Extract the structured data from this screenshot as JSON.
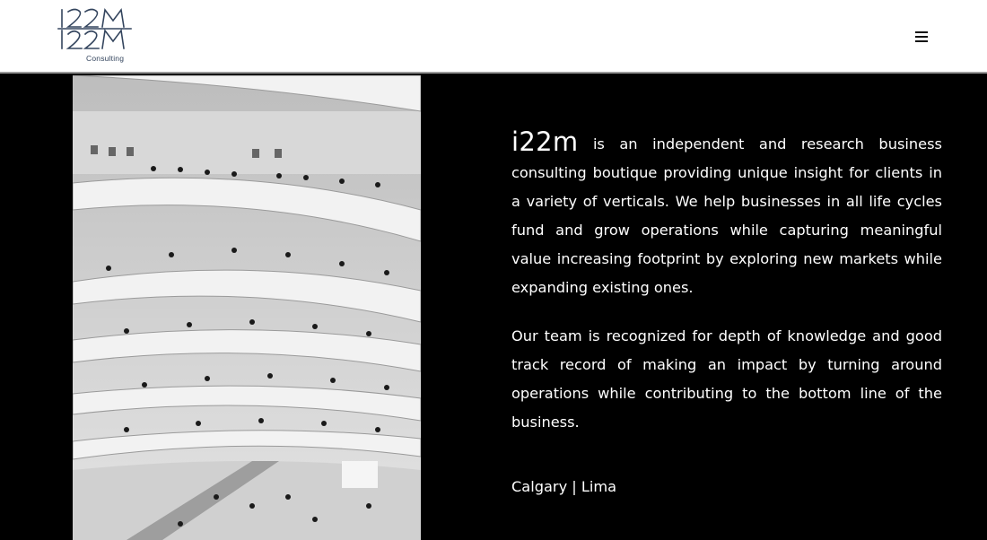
{
  "header": {
    "logo_top": "I22M",
    "logo_main": "I22M",
    "logo_sub": "Consulting",
    "menu_icon": "hamburger-menu-icon"
  },
  "hero": {
    "image_subject": "black-and-white-rotunda-photo"
  },
  "content": {
    "brand": "i22m",
    "intro": "is an independent and research business consulting boutique providing unique insight for clients in a variety of verticals. We help businesses in all life cycles fund and grow operations while capturing meaningful value increasing footprint by exploring new markets while expanding existing ones.",
    "paragraph2": "Our team is recognized for depth of knowledge and good track record of making an impact by turning around operations while contributing to the bottom line of the business.",
    "locations": "Calgary | Lima"
  },
  "colors": {
    "header_bg": "#ffffff",
    "page_bg": "#000000",
    "logo_color": "#34455e",
    "text": "#ffffff"
  }
}
